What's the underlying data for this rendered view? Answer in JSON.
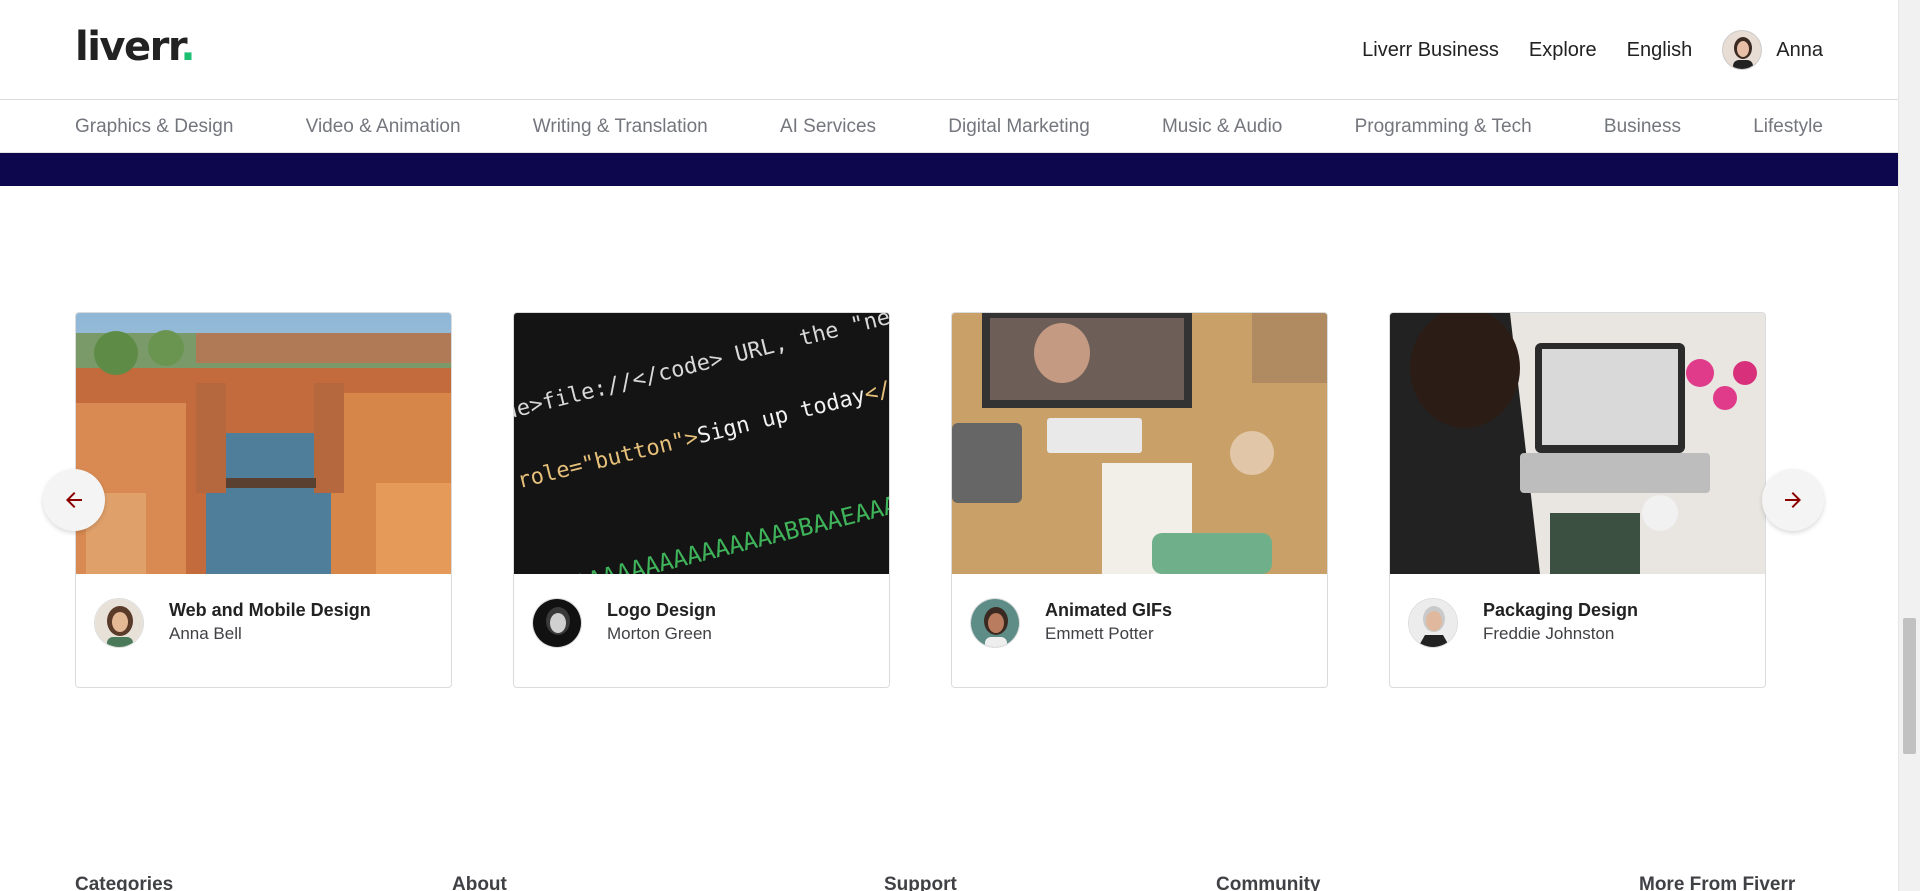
{
  "header": {
    "logo_text": "liverr",
    "logo_dot": ".",
    "nav": [
      "Liverr Business",
      "Explore",
      "English"
    ],
    "user_name": "Anna"
  },
  "categories": [
    "Graphics & Design",
    "Video & Animation",
    "Writing & Translation",
    "AI Services",
    "Digital Marketing",
    "Music & Audio",
    "Programming & Tech",
    "Business",
    "Lifestyle"
  ],
  "cards": [
    {
      "title": "Web and Mobile Design",
      "author": "Anna Bell"
    },
    {
      "title": "Logo Design",
      "author": "Morton Green"
    },
    {
      "title": "Animated GIFs",
      "author": "Emmett Potter"
    },
    {
      "title": "Packaging Design",
      "author": "Freddie Johnston"
    }
  ],
  "footer": [
    "Categories",
    "About",
    "Support",
    "Community",
    "More From Fiverr"
  ],
  "colors": {
    "brand_dot": "#1dbf73",
    "stripe": "#0d084d",
    "arrow": "#8b0000"
  },
  "icons": {
    "prev": "arrow-left-icon",
    "next": "arrow-right-icon"
  }
}
